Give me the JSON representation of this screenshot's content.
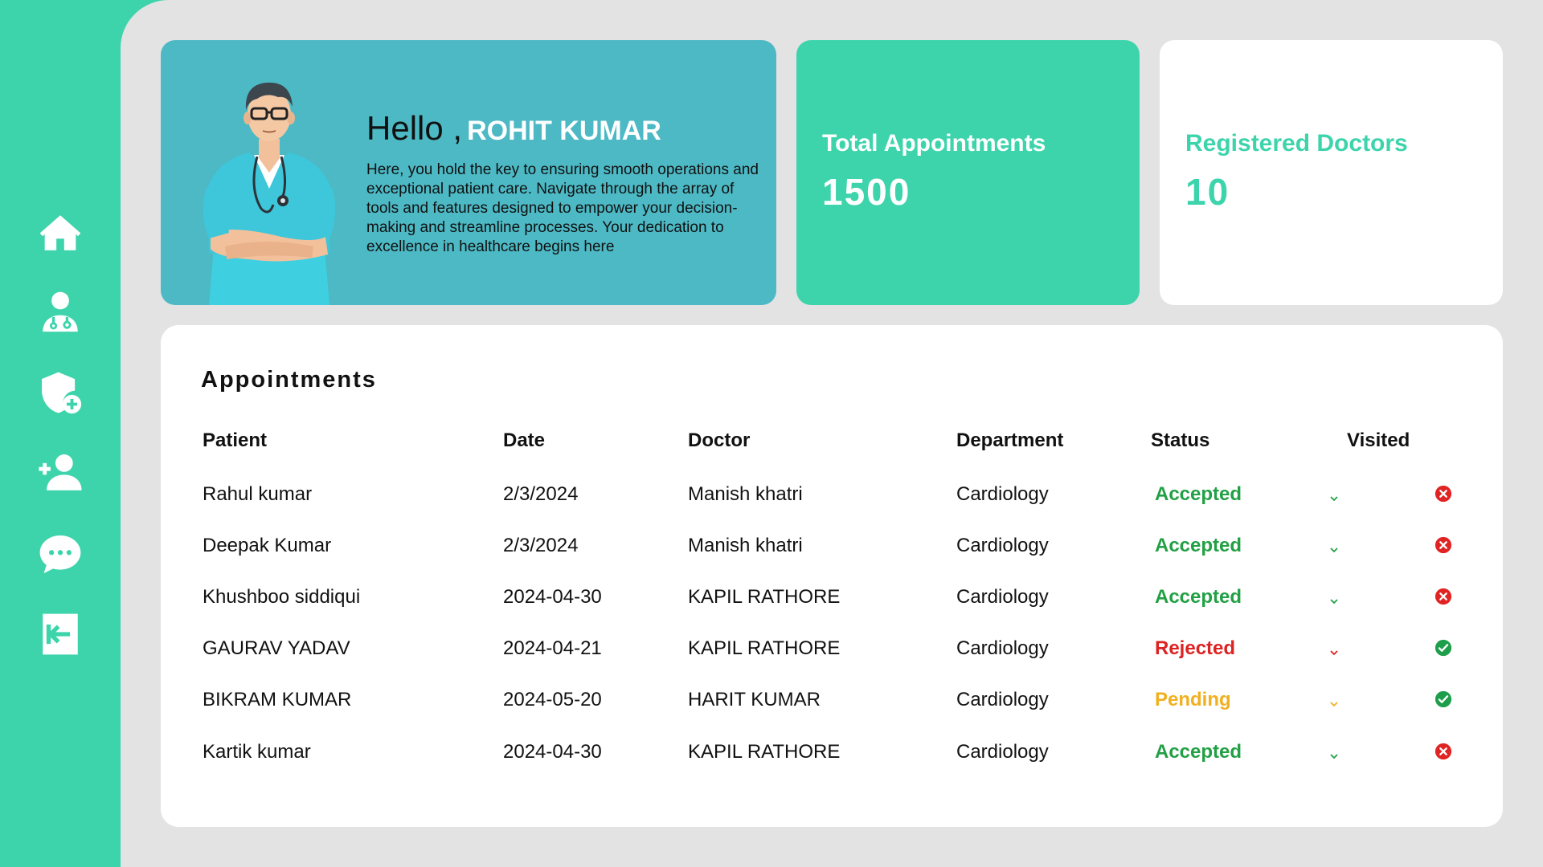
{
  "sidebar": {
    "items": [
      {
        "icon": "home-icon"
      },
      {
        "icon": "doctor-icon"
      },
      {
        "icon": "shield-plus-icon"
      },
      {
        "icon": "add-user-icon"
      },
      {
        "icon": "chat-icon"
      },
      {
        "icon": "logout-icon"
      }
    ]
  },
  "welcome": {
    "greeting": "Hello ,",
    "name": "ROHIT KUMAR",
    "message": "Here, you hold the key to ensuring smooth operations and exceptional patient care. Navigate through the array of tools and features designed to empower your decision-making and streamline processes. Your dedication to excellence in healthcare begins here"
  },
  "stats": {
    "appointments": {
      "label": "Total Appointments",
      "value": "1500"
    },
    "doctors": {
      "label": "Registered Doctors",
      "value": "10"
    }
  },
  "appointments": {
    "title": "Appointments",
    "columns": {
      "patient": "Patient",
      "date": "Date",
      "doctor": "Doctor",
      "department": "Department",
      "status": "Status",
      "visited": "Visited"
    },
    "rows": [
      {
        "patient": "Rahul kumar",
        "date": "2/3/2024",
        "doctor": "Manish khatri",
        "department": "Cardiology",
        "status": "Accepted",
        "visited": false
      },
      {
        "patient": "Deepak Kumar",
        "date": "2/3/2024",
        "doctor": "Manish khatri",
        "department": "Cardiology",
        "status": "Accepted",
        "visited": false
      },
      {
        "patient": "Khushboo siddiqui",
        "date": "2024-04-30",
        "doctor": "KAPIL RATHORE",
        "department": "Cardiology",
        "status": "Accepted",
        "visited": false
      },
      {
        "patient": "GAURAV YADAV",
        "date": "2024-04-21",
        "doctor": "KAPIL RATHORE",
        "department": "Cardiology",
        "status": "Rejected",
        "visited": true
      },
      {
        "patient": "BIKRAM KUMAR",
        "date": "2024-05-20",
        "doctor": "HARIT KUMAR",
        "department": "Cardiology",
        "status": "Pending",
        "visited": true
      },
      {
        "patient": "Kartik kumar",
        "date": "2024-04-30",
        "doctor": "KAPIL RATHORE",
        "department": "Cardiology",
        "status": "Accepted",
        "visited": false
      }
    ]
  },
  "colors": {
    "accent": "#3dd4ac",
    "welcome_card": "#4cb9c5",
    "accepted": "#22a045",
    "rejected": "#dd2222",
    "pending": "#f0b020",
    "visited_yes": "#1e9e4a",
    "visited_no": "#e02424"
  }
}
